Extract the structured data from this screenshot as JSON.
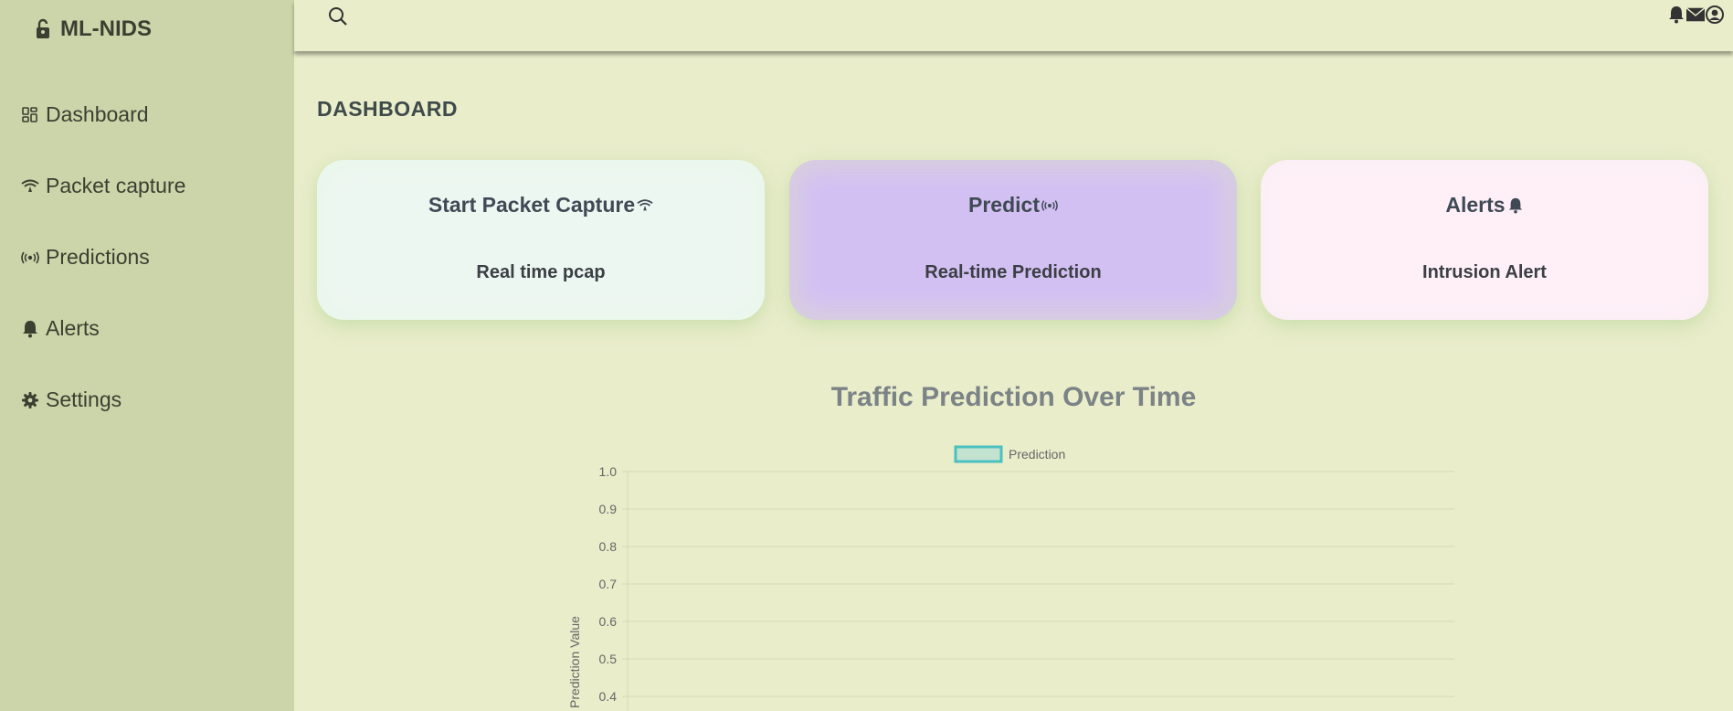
{
  "sidebar": {
    "brand": "ML-NIDS",
    "items": [
      {
        "label": "Dashboard",
        "icon": "dashboard-icon"
      },
      {
        "label": "Packet capture",
        "icon": "wifi-icon"
      },
      {
        "label": "Predictions",
        "icon": "broadcast-icon"
      },
      {
        "label": "Alerts",
        "icon": "bell-icon"
      },
      {
        "label": "Settings",
        "icon": "gear-icon"
      }
    ]
  },
  "topbar": {
    "icons": [
      "search-icon",
      "bell-icon",
      "mail-icon",
      "user-icon"
    ]
  },
  "main": {
    "title": "DASHBOARD",
    "cards": [
      {
        "title": "Start Packet Capture",
        "subtitle": "Real time pcap",
        "icon": "wifi-icon"
      },
      {
        "title": "Predict",
        "subtitle": "Real-time Prediction",
        "icon": "broadcast-icon"
      },
      {
        "title": "Alerts",
        "subtitle": "Intrusion Alert",
        "icon": "bell-icon"
      }
    ]
  },
  "colors": {
    "sidebar_bg": "#ccd4a9",
    "page_bg": "#e9edca",
    "card_capture": "#edf7f1",
    "card_predict": "#d3c0f3",
    "card_alerts": "#fff0f8",
    "series_stroke": "#4bc0c0",
    "series_fill": "#c3e3d0"
  },
  "chart_data": {
    "type": "line",
    "title": "Traffic Prediction Over Time",
    "ylabel": "Prediction Value",
    "xlabel": "",
    "series": [
      {
        "name": "Prediction",
        "values": []
      }
    ],
    "ylim": [
      0.4,
      1.0
    ],
    "yticks": [
      "1.0",
      "0.9",
      "0.8",
      "0.7",
      "0.6",
      "0.5",
      "0.4"
    ],
    "grid": true,
    "legend": "top"
  }
}
